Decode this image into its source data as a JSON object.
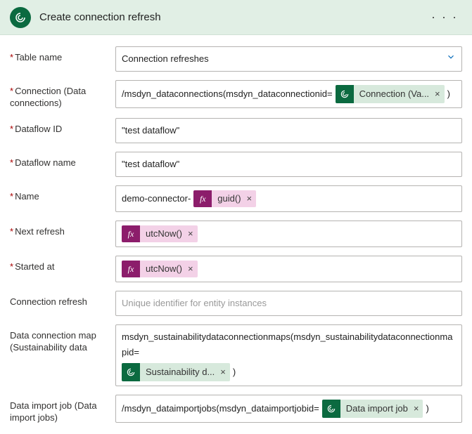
{
  "header": {
    "title": "Create connection refresh",
    "more": "· · ·"
  },
  "rows": {
    "table_name": {
      "label": "Table name",
      "value": "Connection refreshes"
    },
    "connection": {
      "label": "Connection (Data connections)",
      "prefix": "/msdyn_dataconnections(msdyn_dataconnectionid=",
      "token": "Connection (Va...",
      "suffix": ")"
    },
    "dataflow_id": {
      "label": "Dataflow ID",
      "value": "\"test dataflow\""
    },
    "dataflow_name": {
      "label": "Dataflow name",
      "value": "\"test dataflow\""
    },
    "name": {
      "label": "Name",
      "prefix": "demo-connector-",
      "token": "guid()"
    },
    "next_refresh": {
      "label": "Next refresh",
      "token": "utcNow()"
    },
    "started_at": {
      "label": "Started at",
      "token": "utcNow()"
    },
    "conn_refresh": {
      "label": "Connection refresh",
      "placeholder": "Unique identifier for entity instances"
    },
    "map": {
      "label": "Data connection map (Sustainability data",
      "prefix": "msdyn_sustainabilitydataconnectionmaps(msdyn_sustainabilitydataconnectionmapid=",
      "token": "Sustainability d...",
      "suffix": ")"
    },
    "import_job": {
      "label": "Data import job (Data import jobs)",
      "prefix": "/msdyn_dataimportjobs(msdyn_dataimportjobid=",
      "token": "Data import job",
      "suffix": ")"
    }
  },
  "glyphs": {
    "fx": "fx",
    "remove": "×"
  }
}
